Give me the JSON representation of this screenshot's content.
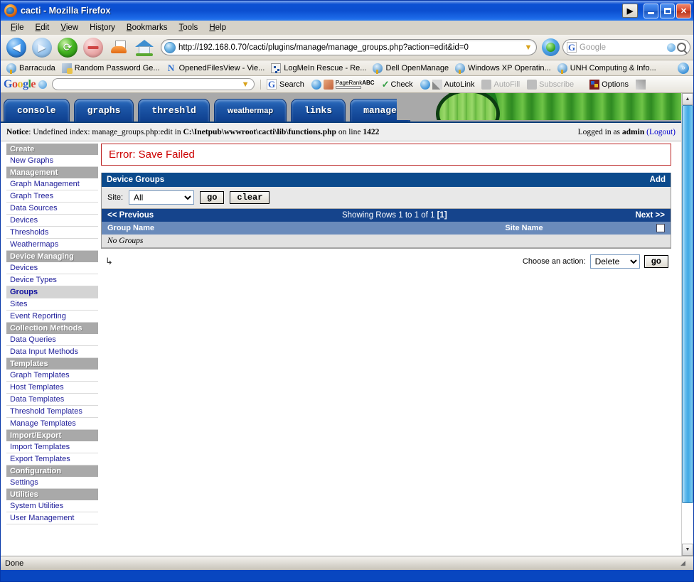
{
  "window": {
    "title": "cacti - Mozilla Firefox",
    "buttons": {
      "play": "▶",
      "minimize": "_",
      "maximize": "□",
      "close": "✕"
    }
  },
  "menubar": {
    "items": [
      "File",
      "Edit",
      "View",
      "History",
      "Bookmarks",
      "Tools",
      "Help"
    ]
  },
  "navbar": {
    "back": "◀",
    "forward": "▶",
    "reload": "⟳",
    "stop": "",
    "home": "",
    "url": "http://192.168.0.70/cacti/plugins/manage/manage_groups.php?action=edit&id=0",
    "search_placeholder": "Google"
  },
  "bookmarks": {
    "items": [
      {
        "label": "Barracuda",
        "icon": "key-icon"
      },
      {
        "label": "Random Password Ge...",
        "icon": "gears-icon"
      },
      {
        "label": "OpenedFilesView - Vie...",
        "icon": "n-letter-icon"
      },
      {
        "label": "LogMeIn Rescue - Re...",
        "icon": "dots-icon"
      },
      {
        "label": "Dell OpenManage",
        "icon": "key-icon"
      },
      {
        "label": "Windows XP Operatin...",
        "icon": "key-icon"
      },
      {
        "label": "UNH Computing & Info...",
        "icon": "key-icon"
      }
    ]
  },
  "google_toolbar": {
    "logo": {
      "g1": "G",
      "o1": "o",
      "o2": "o",
      "g2": "g",
      "l": "l",
      "e": "e"
    },
    "search_value": "",
    "items": [
      {
        "label": "Search",
        "icon": "google-g-icon"
      },
      {
        "label": "PageRank",
        "icon": "pagerank-icon"
      },
      {
        "label": "Check",
        "icon": "spellcheck-icon"
      },
      {
        "label": "AutoLink",
        "icon": "autolink-icon"
      },
      {
        "label": "AutoFill",
        "icon": "autofill-icon",
        "disabled": true
      },
      {
        "label": "Subscribe",
        "icon": "feed-icon",
        "disabled": true
      },
      {
        "label": "Options",
        "icon": "options-icon"
      }
    ]
  },
  "cacti": {
    "tabs": [
      {
        "label": "console",
        "mono": true
      },
      {
        "label": "graphs",
        "mono": true
      },
      {
        "label": "threshld",
        "mono": true
      },
      {
        "label": "weathermap",
        "mono": false
      },
      {
        "label": "links",
        "mono": true
      },
      {
        "label": "manage",
        "mono": true
      }
    ],
    "notice": {
      "prefix": "Notice",
      "text_1": ": Undefined index: manage_groups.php:edit in ",
      "path": "C:\\Inetpub\\wwwroot\\cacti\\lib\\functions.php",
      "text_2": " on line ",
      "line": "1422"
    },
    "logged_in": {
      "text": "Logged in as ",
      "user": "admin",
      "logout": "(Logout)"
    },
    "sidebar": [
      {
        "type": "head",
        "label": "Create"
      },
      {
        "type": "item",
        "label": "New Graphs"
      },
      {
        "type": "head",
        "label": "Management"
      },
      {
        "type": "item",
        "label": "Graph Management"
      },
      {
        "type": "item",
        "label": "Graph Trees"
      },
      {
        "type": "item",
        "label": "Data Sources"
      },
      {
        "type": "item",
        "label": "Devices"
      },
      {
        "type": "item",
        "label": "Thresholds"
      },
      {
        "type": "item",
        "label": "Weathermaps"
      },
      {
        "type": "head",
        "label": "Device Managing"
      },
      {
        "type": "item",
        "label": "Devices"
      },
      {
        "type": "item",
        "label": "Device Types"
      },
      {
        "type": "item",
        "label": "Groups",
        "active": true
      },
      {
        "type": "item",
        "label": "Sites"
      },
      {
        "type": "item",
        "label": "Event Reporting"
      },
      {
        "type": "head",
        "label": "Collection Methods"
      },
      {
        "type": "item",
        "label": "Data Queries"
      },
      {
        "type": "item",
        "label": "Data Input Methods"
      },
      {
        "type": "head",
        "label": "Templates"
      },
      {
        "type": "item",
        "label": "Graph Templates"
      },
      {
        "type": "item",
        "label": "Host Templates"
      },
      {
        "type": "item",
        "label": "Data Templates"
      },
      {
        "type": "item",
        "label": "Threshold Templates"
      },
      {
        "type": "item",
        "label": "Manage Templates"
      },
      {
        "type": "head",
        "label": "Import/Export"
      },
      {
        "type": "item",
        "label": "Import Templates"
      },
      {
        "type": "item",
        "label": "Export Templates"
      },
      {
        "type": "head",
        "label": "Configuration"
      },
      {
        "type": "item",
        "label": "Settings"
      },
      {
        "type": "head",
        "label": "Utilities"
      },
      {
        "type": "item",
        "label": "System Utilities"
      },
      {
        "type": "item",
        "label": "User Management"
      }
    ],
    "error": "Error: Save Failed",
    "panel": {
      "title": "Device Groups",
      "add_label": "Add",
      "filter": {
        "site_label": "Site:",
        "site_value": "All",
        "site_options": [
          "All"
        ],
        "go_label": "go",
        "clear_label": "clear"
      },
      "nav": {
        "previous": "<< Previous",
        "showing": "Showing Rows 1 to 1 of 1 ",
        "page": "[1]",
        "next": "Next >>"
      },
      "columns": [
        "Group Name",
        "Site Name"
      ],
      "rows": [],
      "empty_text": "No Groups",
      "action": {
        "label": "Choose an action:",
        "value": "Delete",
        "options": [
          "Delete"
        ],
        "go_label": "go"
      }
    }
  },
  "statusbar": {
    "text": "Done"
  },
  "colors": {
    "panel_header": "#0b4a8c",
    "nav_row": "#15448c",
    "column_header": "#6a8bbb",
    "sidebar_header": "#a9a9a9",
    "error_text": "#cc0000",
    "link": "#21209b"
  }
}
